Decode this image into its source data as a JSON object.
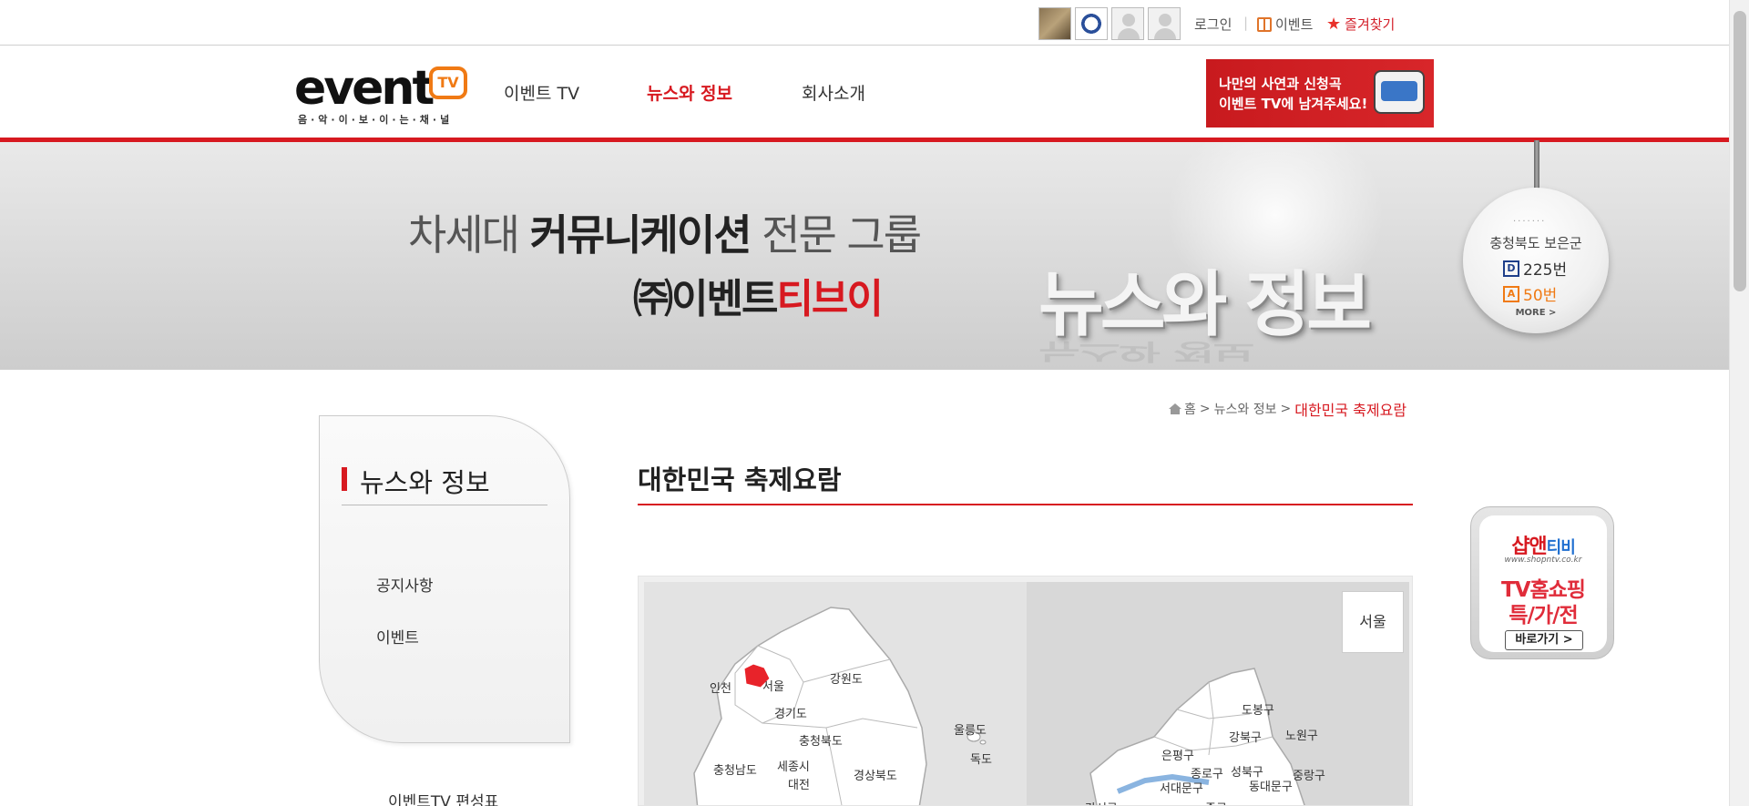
{
  "topbar": {
    "thumbnails": [
      "thumbnail-photo",
      "thumbnail-emblem",
      "thumbnail-avatar",
      "thumbnail-avatar"
    ],
    "login": "로그인",
    "event": "이벤트",
    "favorites": "즐겨찾기"
  },
  "header": {
    "logo_word": "event",
    "logo_tv": "TV",
    "logo_sub": "음·악·이·보·이·는·채·널",
    "nav": [
      "이벤트 TV",
      "뉴스와 정보",
      "회사소개"
    ],
    "promo_line1": "나만의 사연과 신청곡",
    "promo_line2": "이벤트 TV에 남겨주세요!"
  },
  "banner": {
    "line1_a": "차세대 ",
    "line1_b": "커뮤니케이션",
    "line1_c": " 전문 그룹",
    "line2_a": "㈜이벤트",
    "line2_b": "티브이",
    "big_title": "뉴스와 정보"
  },
  "channel": {
    "region": "충청북도 보은군",
    "d_badge": "D",
    "d_number": "225번",
    "a_badge": "A",
    "a_number": "50번",
    "more": "MORE >"
  },
  "breadcrumb": {
    "home": "홈",
    "section": "뉴스와 정보",
    "current": "대한민국 축제요람"
  },
  "sidebar": {
    "title": "뉴스와 정보",
    "items": [
      "공지사항",
      "이벤트"
    ],
    "schedule": "이벤트TV 편성표"
  },
  "main": {
    "title": "대한민국 축제요람"
  },
  "map": {
    "provinces": [
      "인천",
      "서울",
      "강원도",
      "경기도",
      "충청북도",
      "울릉도",
      "독도",
      "충청남도",
      "세종시",
      "대전",
      "경상북도"
    ],
    "selected_box": "서울",
    "districts": [
      "도봉구",
      "강북구",
      "노원구",
      "은평구",
      "종로구",
      "성북구",
      "중랑구",
      "서대문구",
      "동대문구",
      "강서구",
      "중구"
    ],
    "selected_color": "#e8232a"
  },
  "ad": {
    "brand_a": "샵앤",
    "brand_b": "티비",
    "url": "www.shopntv.co.kr",
    "line1": "TV홈쇼핑",
    "line2": "특/가/전",
    "button": "바로가기 >"
  },
  "colors": {
    "accent": "#d71920",
    "logo_orange": "#f07a14"
  }
}
